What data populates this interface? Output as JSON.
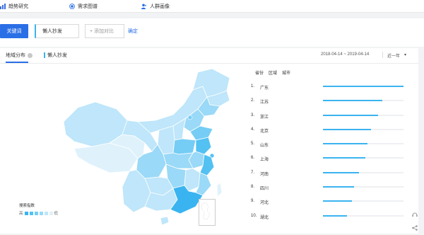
{
  "topnav": {
    "trend": "趋势研究",
    "demand": "需求图谱",
    "crowd": "人群画像"
  },
  "search": {
    "keyword_button": "关键词",
    "keyword_value": "懒人抄发",
    "add_compare": "+ 添加对比",
    "confirm": "确定"
  },
  "panel": {
    "tab_region": "地域分布",
    "keyword_tag": "懒人抄发",
    "date_range": "2018-04-14 ~ 2019-04-14",
    "period": "近一年",
    "period_caret": "▾"
  },
  "legend": {
    "title": "搜索指数",
    "high": "高",
    "low": "低",
    "colors": [
      "#3ab4f0",
      "#53c1f2",
      "#75cdf5",
      "#9ad9f7",
      "#bfe6fa",
      "#dff2fc"
    ]
  },
  "ranking": {
    "tabs": [
      "省份",
      "区域",
      "城市"
    ],
    "items": [
      {
        "rank": "1.",
        "name": "广东",
        "value": 1.0
      },
      {
        "rank": "2.",
        "name": "江苏",
        "value": 0.74
      },
      {
        "rank": "3.",
        "name": "浙江",
        "value": 0.68
      },
      {
        "rank": "4.",
        "name": "北京",
        "value": 0.6
      },
      {
        "rank": "5.",
        "name": "山东",
        "value": 0.55
      },
      {
        "rank": "6.",
        "name": "上海",
        "value": 0.53
      },
      {
        "rank": "7.",
        "name": "河南",
        "value": 0.45
      },
      {
        "rank": "8.",
        "name": "四川",
        "value": 0.39
      },
      {
        "rank": "9.",
        "name": "河北",
        "value": 0.36
      },
      {
        "rank": "10.",
        "name": "湖北",
        "value": 0.3
      }
    ]
  },
  "colors": {
    "accent": "#2b6fe6",
    "bar": "#3ab4f0"
  }
}
